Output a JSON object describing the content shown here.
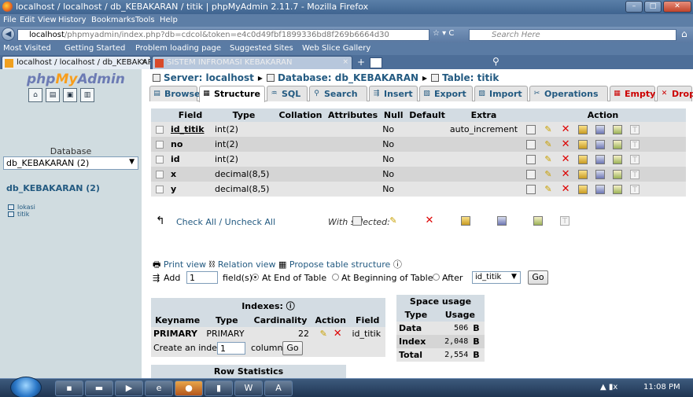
{
  "window": {
    "title": "localhost / localhost / db_KEBAKARAN / titik | phpMyAdmin 2.11.7 - Mozilla Firefox",
    "minimize": "–",
    "maximize": "□",
    "close": "✕"
  },
  "menu": [
    "File",
    "Edit",
    "View",
    "History",
    "Bookmarks",
    "Tools",
    "Help"
  ],
  "nav": {
    "url_host": "localhost",
    "url_path": "/phpmyadmin/index.php?db=cdcol&token=e4c0d49fbf1899336bd8f269b6664d30",
    "search_placeholder": "Search Here"
  },
  "bookmarks": [
    "Most Visited",
    "Getting Started",
    "Problem loading page",
    "Suggested Sites",
    "Web Slice Gallery"
  ],
  "browser_tabs": [
    {
      "label": "localhost / localhost / db_KEBAKARA...",
      "close": "×",
      "active": true
    },
    {
      "label": "SISTEM INFROMASI KEBAKARAN",
      "close": "×",
      "active": false
    }
  ],
  "sidebar": {
    "logo_php": "php",
    "logo_my": "My",
    "logo_admin": "Admin",
    "db_header": "Database",
    "db_selected": "db_KEBAKARAN (2)",
    "db_link": "db_KEBAKARAN (2)",
    "tables": [
      "lokasi",
      "titik"
    ]
  },
  "breadcrumb": {
    "server": "Server: localhost",
    "database": "Database: db_KEBAKARAN",
    "table": "Table: titik",
    "sep": "▸"
  },
  "tabs": [
    "Browse",
    "Structure",
    "SQL",
    "Search",
    "Insert",
    "Export",
    "Import",
    "Operations",
    "Empty",
    "Drop"
  ],
  "structure": {
    "columns": [
      "Field",
      "Type",
      "Collation",
      "Attributes",
      "Null",
      "Default",
      "Extra",
      "Action"
    ],
    "rows": [
      {
        "field": "id_titik",
        "type": "int(2)",
        "collation": "",
        "attributes": "",
        "null": "No",
        "default": "",
        "extra": "auto_increment"
      },
      {
        "field": "no",
        "type": "int(2)",
        "collation": "",
        "attributes": "",
        "null": "No",
        "default": "",
        "extra": ""
      },
      {
        "field": "id",
        "type": "int(2)",
        "collation": "",
        "attributes": "",
        "null": "No",
        "default": "",
        "extra": ""
      },
      {
        "field": "x",
        "type": "decimal(8,5)",
        "collation": "",
        "attributes": "",
        "null": "No",
        "default": "",
        "extra": ""
      },
      {
        "field": "y",
        "type": "decimal(8,5)",
        "collation": "",
        "attributes": "",
        "null": "No",
        "default": "",
        "extra": ""
      }
    ],
    "check_all": "Check All / Uncheck All",
    "with_selected": "With selected:"
  },
  "links": {
    "print_view": "Print view",
    "relation_view": "Relation view",
    "propose": "Propose table structure"
  },
  "add_field": {
    "label": "Add",
    "count": "1",
    "fields_text": "field(s)",
    "end": "At End of Table",
    "beginning": "At Beginning of Table",
    "after": "After",
    "after_value": "id_titik",
    "go": "Go"
  },
  "indexes": {
    "title": "Indexes:",
    "columns": [
      "Keyname",
      "Type",
      "Cardinality",
      "Action",
      "Field"
    ],
    "rows": [
      {
        "keyname": "PRIMARY",
        "type": "PRIMARY",
        "cardinality": "22",
        "field": "id_titik"
      }
    ],
    "create_label": "Create an index on",
    "create_count": "1",
    "columns_label": "columns",
    "go": "Go"
  },
  "space": {
    "title": "Space usage",
    "type_header": "Type",
    "usage_header": "Usage",
    "rows": [
      {
        "type": "Data",
        "value": "506",
        "unit": "B"
      },
      {
        "type": "Index",
        "value": "2,048",
        "unit": "B"
      },
      {
        "type": "Total",
        "value": "2,554",
        "unit": "B"
      }
    ]
  },
  "row_statistics": "Row Statistics",
  "taskbar": {
    "time": "11:08 PM"
  }
}
